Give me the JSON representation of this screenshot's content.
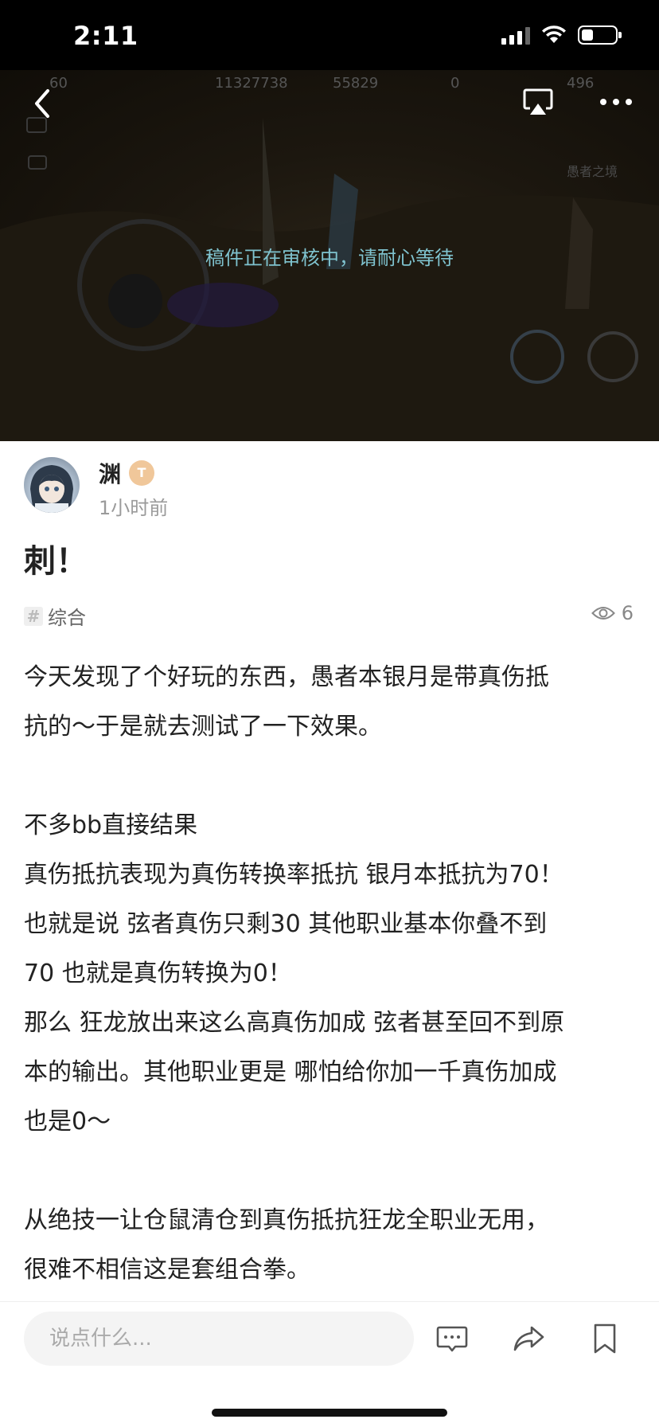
{
  "status_bar": {
    "time": "2:11",
    "battery_level": 0.35
  },
  "video": {
    "review_notice": "稿件正在审核中，请耐心等待",
    "hud": {
      "level": "60",
      "gold": "11327738",
      "diamond": "55829",
      "energy": "0",
      "other": "496",
      "corner_text": "愚者之境"
    }
  },
  "author": {
    "name": "渊",
    "time": "1小时前",
    "badge": "T"
  },
  "post": {
    "title": "刺！",
    "tag": "综合",
    "views": "6",
    "paragraphs": [
      "今天发现了个好玩的东西，愚者本银月是带真伤抵",
      "抗的～于是就去测试了一下效果。",
      "",
      "不多bb直接结果",
      "真伤抵抗表现为真伤转换率抵抗 银月本抵抗为70！",
      "也就是说 弦者真伤只剩30 其他职业基本你叠不到",
      "70 也就是真伤转换为0！",
      "那么 狂龙放出来这么高真伤加成 弦者甚至回不到原",
      "本的输出。其他职业更是 哪怕给你加一千真伤加成",
      "也是0～",
      "",
      "从绝技一让仓鼠清仓到真伤抵抗狂龙全职业无用，",
      "很难不相信这是套组合拳。"
    ]
  },
  "bottom_bar": {
    "comment_placeholder": "说点什么..."
  },
  "icons": {
    "back": "chevron-left-icon",
    "cast": "airplay-icon",
    "more": "more-dots-icon",
    "eye": "eye-icon",
    "comment": "comment-icon",
    "share": "share-icon",
    "bookmark": "bookmark-icon"
  }
}
